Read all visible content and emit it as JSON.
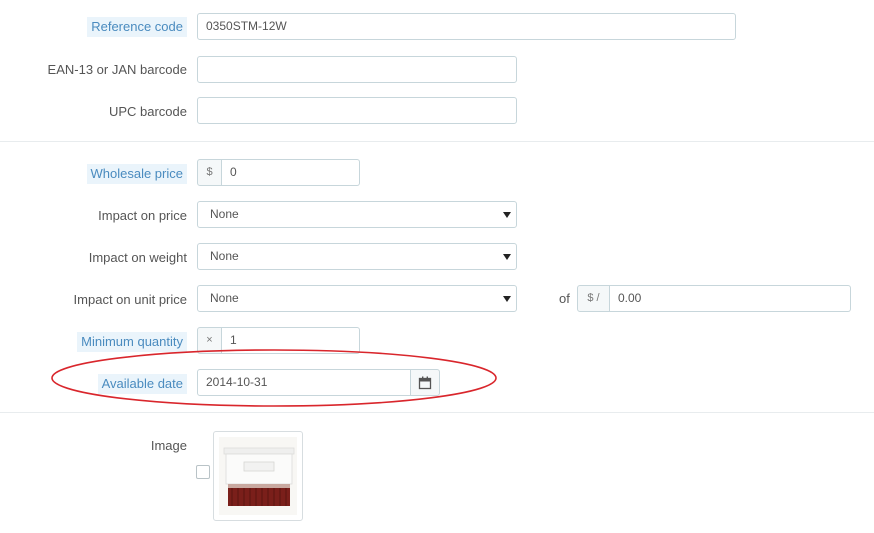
{
  "fields": {
    "reference": {
      "label": "Reference code",
      "value": "0350STM-12W"
    },
    "ean": {
      "label": "EAN-13 or JAN barcode",
      "value": ""
    },
    "upc": {
      "label": "UPC barcode",
      "value": ""
    },
    "wholesale": {
      "label": "Wholesale price",
      "prefix": "$",
      "value": "0"
    },
    "impact_price": {
      "label": "Impact on price",
      "value": "None"
    },
    "impact_weight": {
      "label": "Impact on weight",
      "value": "None"
    },
    "impact_unit": {
      "label": "Impact on unit price",
      "value": "None",
      "of_label": "of",
      "unit_prefix": "$ /",
      "unit_value": "0.00"
    },
    "min_qty": {
      "label": "Minimum quantity",
      "prefix": "×",
      "value": "1"
    },
    "available_date": {
      "label": "Available date",
      "value": "2014-10-31",
      "icon": "calendar-icon"
    },
    "image": {
      "label": "Image"
    }
  },
  "annotation": {
    "color": "#d9262c"
  }
}
